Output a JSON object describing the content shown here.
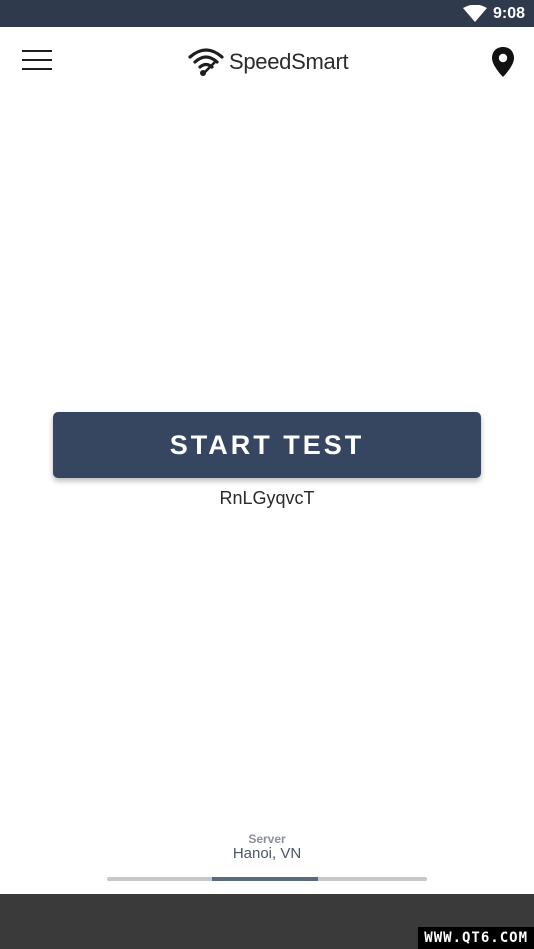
{
  "status_bar": {
    "time": "9:08",
    "wifi_icon": "wifi-icon",
    "background": "#2f3a4c"
  },
  "header": {
    "menu_icon": "hamburger-menu-icon",
    "logo_icon": "wifi-speed-logo-icon",
    "app_name": "SpeedSmart",
    "location_icon": "map-pin-icon"
  },
  "main": {
    "start_button_label": "START TEST",
    "provider": "RnLGyqvcT",
    "button_color": "#364660"
  },
  "server": {
    "label": "Server",
    "location": "Hanoi, VN"
  },
  "pager": {
    "page_count": 3,
    "active_page": 2
  },
  "watermark": {
    "text": "WWW.QT6.COM"
  }
}
